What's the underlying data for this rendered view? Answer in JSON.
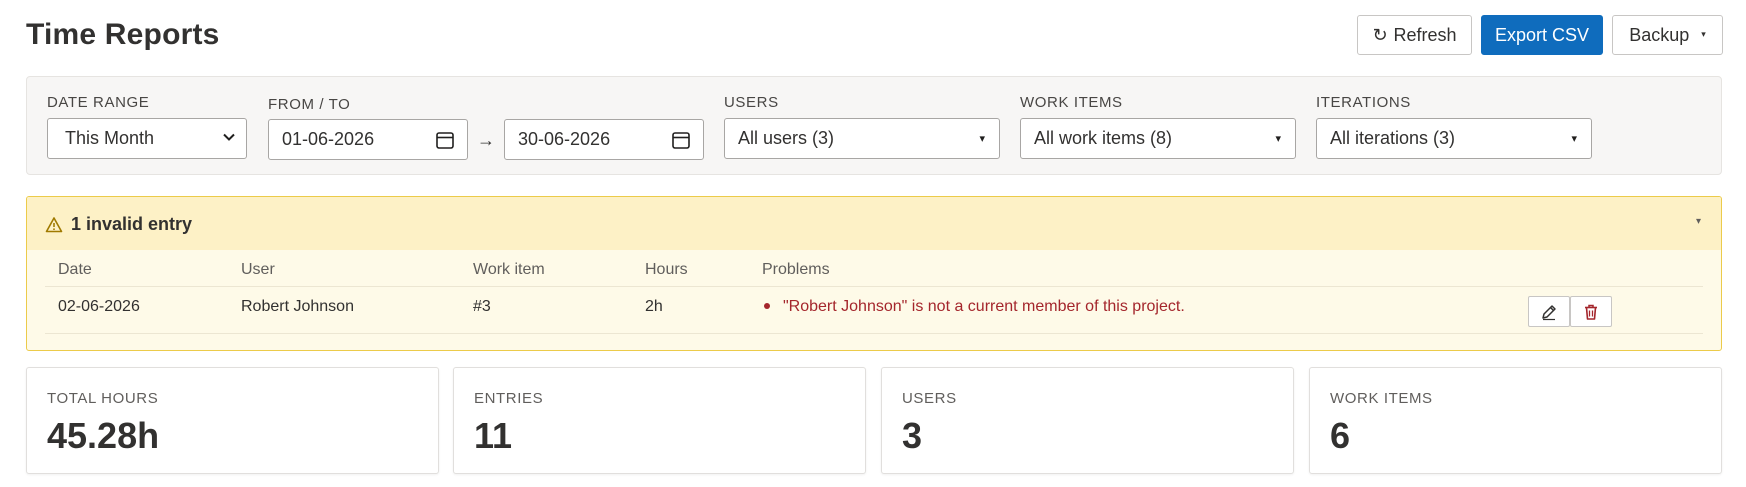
{
  "page": {
    "title": "Time Reports"
  },
  "toolbar": {
    "refresh_icon": "↻",
    "refresh_label": "Refresh",
    "export_label": "Export CSV",
    "backup_label": "Backup",
    "backup_caret": "▾"
  },
  "filters": {
    "date_range": {
      "label": "DATE RANGE",
      "value": "This Month"
    },
    "from_to": {
      "label": "FROM / TO",
      "from": "01-06-2026",
      "arrow": "→",
      "to": "30-06-2026"
    },
    "users": {
      "label": "USERS",
      "value": "All users (3)"
    },
    "work_items": {
      "label": "WORK ITEMS",
      "value": "All work items (8)"
    },
    "iterations": {
      "label": "ITERATIONS",
      "value": "All iterations (3)"
    },
    "caret": "▾"
  },
  "invalid": {
    "title": "1 invalid entry",
    "toggle": "▾",
    "columns": [
      "Date",
      "User",
      "Work item",
      "Hours",
      "Problems"
    ],
    "rows": [
      {
        "date": "02-06-2026",
        "user": "Robert Johnson",
        "work_item": "#3",
        "hours": "2h",
        "problem": "\"Robert Johnson\" is not a current member of this project."
      }
    ]
  },
  "stats": [
    {
      "label": "TOTAL HOURS",
      "value": "45.28h"
    },
    {
      "label": "ENTRIES",
      "value": "11"
    },
    {
      "label": "USERS",
      "value": "3"
    },
    {
      "label": "WORK ITEMS",
      "value": "6"
    }
  ],
  "colors": {
    "primary": "#0f6cbd",
    "warning_bg": "#fdf1c6",
    "warning_border": "#eccb4a",
    "error_text": "#a4262c"
  },
  "icons": [
    "refresh-icon",
    "calendar-icon",
    "warning-icon",
    "edit-icon",
    "trash-icon",
    "chevron-down-icon"
  ]
}
